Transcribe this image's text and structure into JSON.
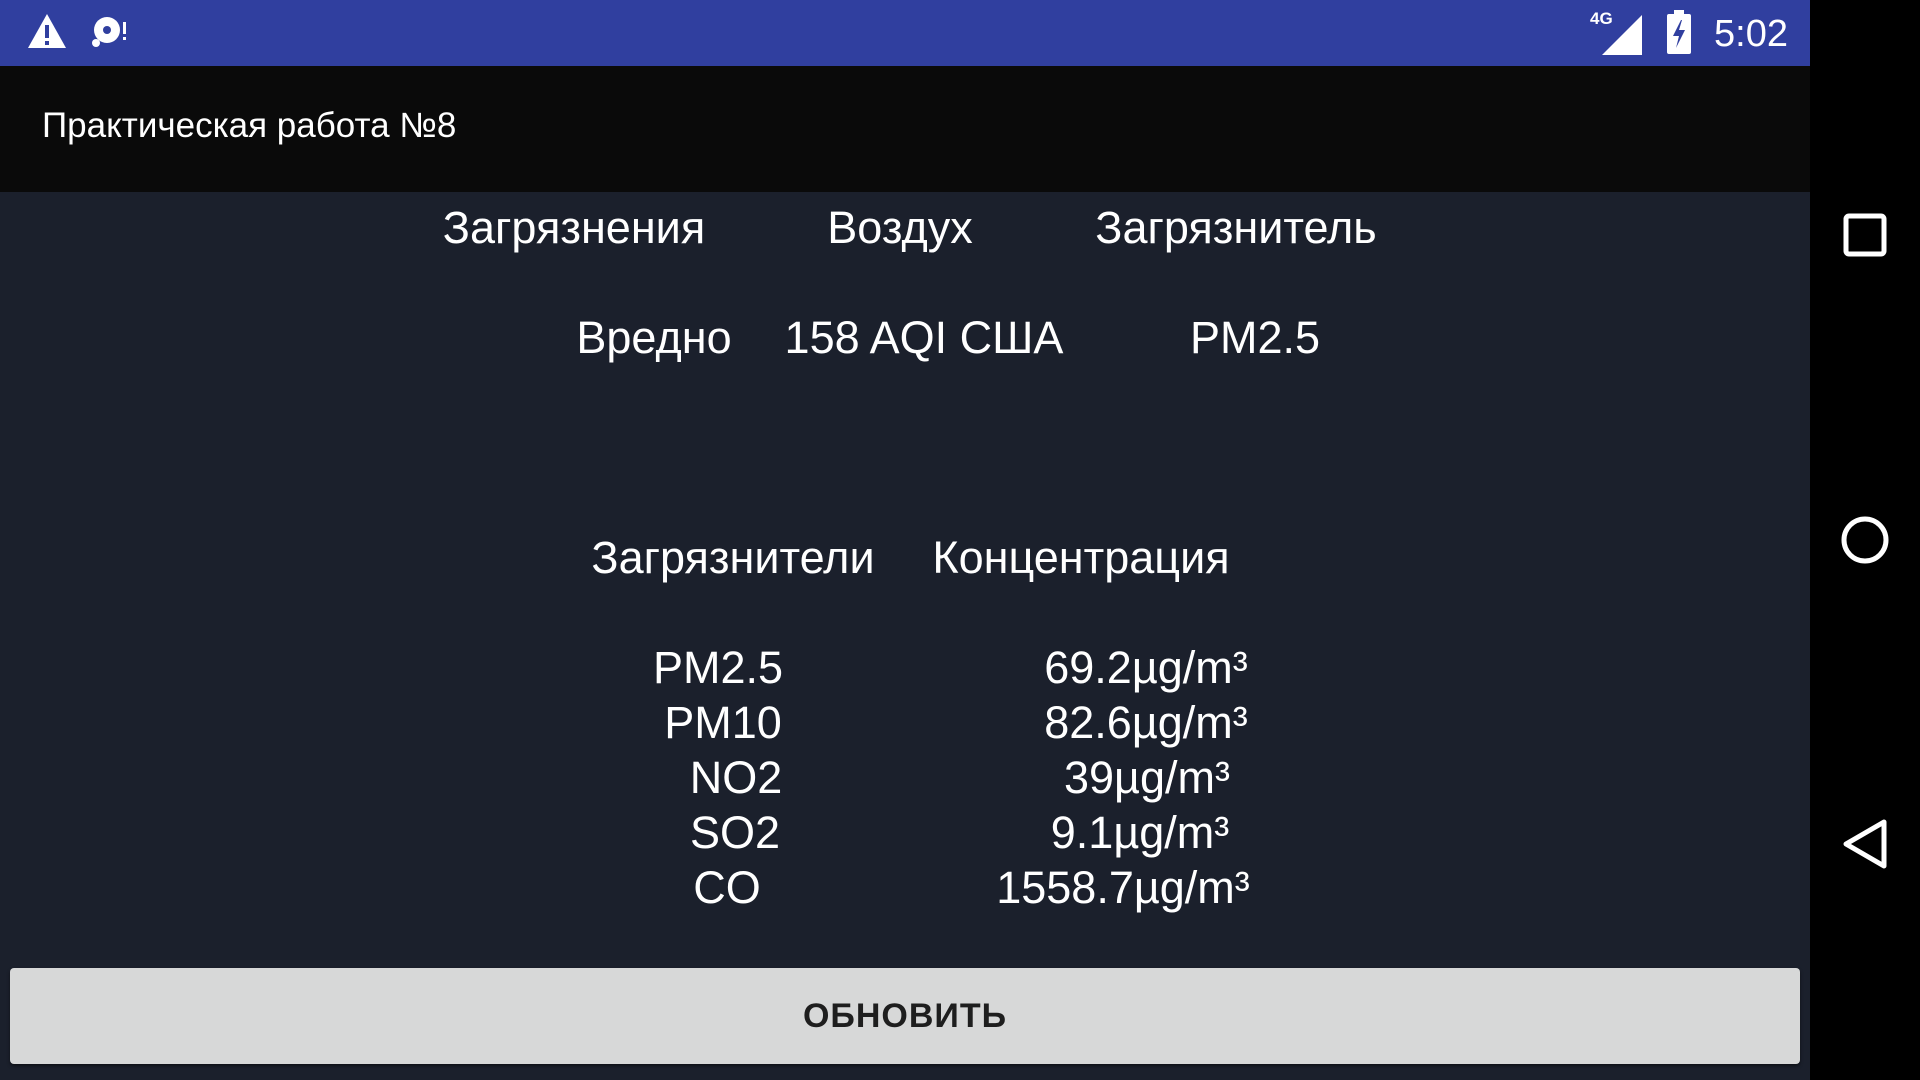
{
  "status_bar": {
    "time": "5:02",
    "network": "4G",
    "icons": [
      "warning-icon",
      "notification-icon",
      "signal-icon",
      "battery-charging-icon"
    ]
  },
  "toolbar": {
    "title": "Практическая работа №8"
  },
  "summary": {
    "headers": [
      "Загрязнения",
      "Воздух",
      "Загрязнитель"
    ],
    "values": [
      "Вредно",
      "158 AQI США",
      "PM2.5"
    ]
  },
  "pollutants": {
    "headers": [
      "Загрязнители",
      "Концентрация"
    ],
    "rows": [
      {
        "name": "PM2.5",
        "value": "69.2µg/m³"
      },
      {
        "name": "PM10",
        "value": "82.6µg/m³"
      },
      {
        "name": "NO2",
        "value": "39µg/m³"
      },
      {
        "name": "SO2",
        "value": "9.1µg/m³"
      },
      {
        "name": "CO",
        "value": "1558.7µg/m³"
      }
    ]
  },
  "refresh_button": {
    "label": "ОБНОВИТЬ"
  },
  "nav_bar": {
    "icons": [
      "recents-icon",
      "home-icon",
      "back-icon"
    ]
  },
  "colors": {
    "status_bar": "#303f9f",
    "toolbar": "#0a0a0a",
    "content_bg": "#1b202c",
    "button_bg": "#d7d8d8"
  }
}
